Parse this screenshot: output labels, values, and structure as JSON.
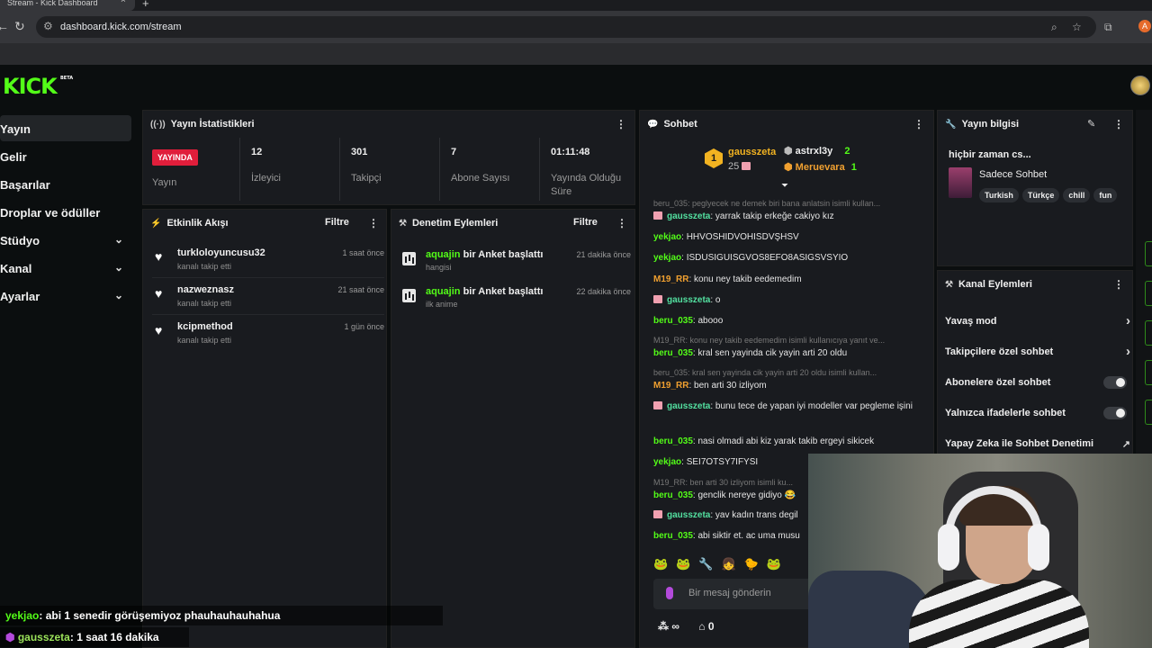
{
  "browser": {
    "tab_title": "Stream - Kick Dashboard",
    "tab_close": "×",
    "new_tab": "+",
    "url": "dashboard.kick.com/stream",
    "back": "←",
    "forward": "→",
    "reload": "↻",
    "profile_initial": "A"
  },
  "app": {
    "logo": "KICK",
    "logo_badge": "BETA"
  },
  "sidebar": {
    "items": [
      {
        "label": "Yayın",
        "active": true
      },
      {
        "label": "Gelir"
      },
      {
        "label": "Başarılar"
      },
      {
        "label": "Droplar ve ödüller"
      },
      {
        "label": "Stüdyo",
        "chevron": "⌄"
      },
      {
        "label": "Kanal",
        "chevron": "⌄"
      },
      {
        "label": "Ayarlar",
        "chevron": "⌄"
      }
    ]
  },
  "stats": {
    "title": "Yayın İstatistikleri",
    "live_badge": "YAYINDA",
    "status_label": "Yayın",
    "viewers": {
      "value": "12",
      "label": "İzleyici"
    },
    "followers": {
      "value": "301",
      "label": "Takipçi"
    },
    "subs": {
      "value": "7",
      "label": "Abone Sayısı"
    },
    "uptime": {
      "value": "01:11:48",
      "label": "Yayında Olduğu Süre"
    },
    "menu": "⋮"
  },
  "activity": {
    "title": "Etkinlik Akışı",
    "filter": "Filtre",
    "items": [
      {
        "name": "turkloloyuncusu32",
        "sub": "kanalı takip etti",
        "time": "1 saat önce"
      },
      {
        "name": "nazweznasz",
        "sub": "kanalı takip etti",
        "time": "21 saat önce"
      },
      {
        "name": "kcipmethod",
        "sub": "kanalı takip etti",
        "time": "1 gün önce"
      }
    ]
  },
  "moderation": {
    "title": "Denetim Eylemleri",
    "filter": "Filtre",
    "items": [
      {
        "user": "aquajin",
        "action": "bir Anket başlattı",
        "sub": "hangisi",
        "time": "21 dakika önce"
      },
      {
        "user": "aquajin",
        "action": "bir Anket başlattı",
        "sub": "ilk anime",
        "time": "22 dakika önce"
      }
    ]
  },
  "chat": {
    "title": "Sohbet",
    "leaderboard": {
      "first": {
        "rank": "1",
        "name": "gausszeta",
        "count": "25"
      },
      "second": {
        "name": "astrxl3y",
        "count": "2"
      },
      "third": {
        "name": "Meruevara",
        "count": "1"
      }
    },
    "messages": [
      {
        "reply": "beru_035: peglyecek ne demek biri bana anlatsin isimli kullan..."
      },
      {
        "user": "gausszeta",
        "color": "#53e0a0",
        "gift": true,
        "text": "yarrak takip erkeğe cakiyo kız"
      },
      {
        "user": "yekjao",
        "color": "#53fc18",
        "text": "HHVOSHIDVOHISDVŞHSV"
      },
      {
        "user": "yekjao",
        "color": "#53fc18",
        "text": "ISDUSIGUISGVOS8EFO8ASIGSVSYIO"
      },
      {
        "user": "M19_RR",
        "color": "#f0a030",
        "text": "konu ney takib eedemedim"
      },
      {
        "user": "gausszeta",
        "color": "#53e0a0",
        "gift": true,
        "text": "o"
      },
      {
        "user": "beru_035",
        "color": "#53fc18",
        "text": "abooo"
      },
      {
        "reply": "M19_RR: konu ney takib eedemedim isimli kullanıcıya yanıt ve..."
      },
      {
        "user": "beru_035",
        "color": "#53fc18",
        "text": "kral sen yayinda cik yayin arti 20 oldu"
      },
      {
        "reply": "beru_035: kral sen yayinda cik yayin arti 20 oldu isimli kullan..."
      },
      {
        "user": "M19_RR",
        "color": "#f0a030",
        "text": "ben arti 30 izliyom"
      },
      {
        "user": "gausszeta",
        "color": "#53e0a0",
        "gift": true,
        "text": "bunu tece de yapan iyi modeller var pegleme işini"
      },
      {
        "user": "beru_035",
        "color": "#53fc18",
        "text": "nasi olmadi abi kiz yarak takib ergeyi sikicek"
      },
      {
        "user": "yekjao",
        "color": "#53fc18",
        "text": "SEI7OTSY7IFYSI"
      },
      {
        "reply": "M19_RR: ben arti 30 izliyom isimli ku..."
      },
      {
        "user": "beru_035",
        "color": "#53fc18",
        "text": "genclik nereye gidiyo 😂"
      },
      {
        "user": "gausszeta",
        "color": "#53e0a0",
        "gift": true,
        "text": "yav kadın trans degil"
      },
      {
        "user": "beru_035",
        "color": "#53fc18",
        "text": "abi siktir et. ac uma musu"
      }
    ],
    "emotes": "🐸🐸🔧👧🐤🐸",
    "input_placeholder": "Bir mesaj gönderin",
    "footer_count": "0",
    "footer_infinity": "∞"
  },
  "stream_info": {
    "title": "Yayın bilgisi",
    "stream_title": "hiçbir zaman cs...",
    "category": "Sadece Sohbet",
    "tags": [
      "Turkish",
      "Türkçe",
      "chill",
      "fun"
    ]
  },
  "channel_actions": {
    "title": "Kanal Eylemleri",
    "items": [
      {
        "label": "Yavaş mod",
        "control": "arrow"
      },
      {
        "label": "Takipçilere özel sohbet",
        "control": "arrow"
      },
      {
        "label": "Abonelere özel sohbet",
        "control": "toggle"
      },
      {
        "label": "Yalnızca ifadelerle sohbet",
        "control": "toggle"
      },
      {
        "label": "Yapay Zeka ile Sohbet Denetimi",
        "control": "external"
      }
    ]
  },
  "overlay": {
    "line1": {
      "user": "yekjao",
      "text": ": abi 1 senedir görüşemiyoz phauhauhauhahua"
    },
    "line2": {
      "user": "gausszeta",
      "text": ": 1 saat 16 dakika"
    }
  }
}
